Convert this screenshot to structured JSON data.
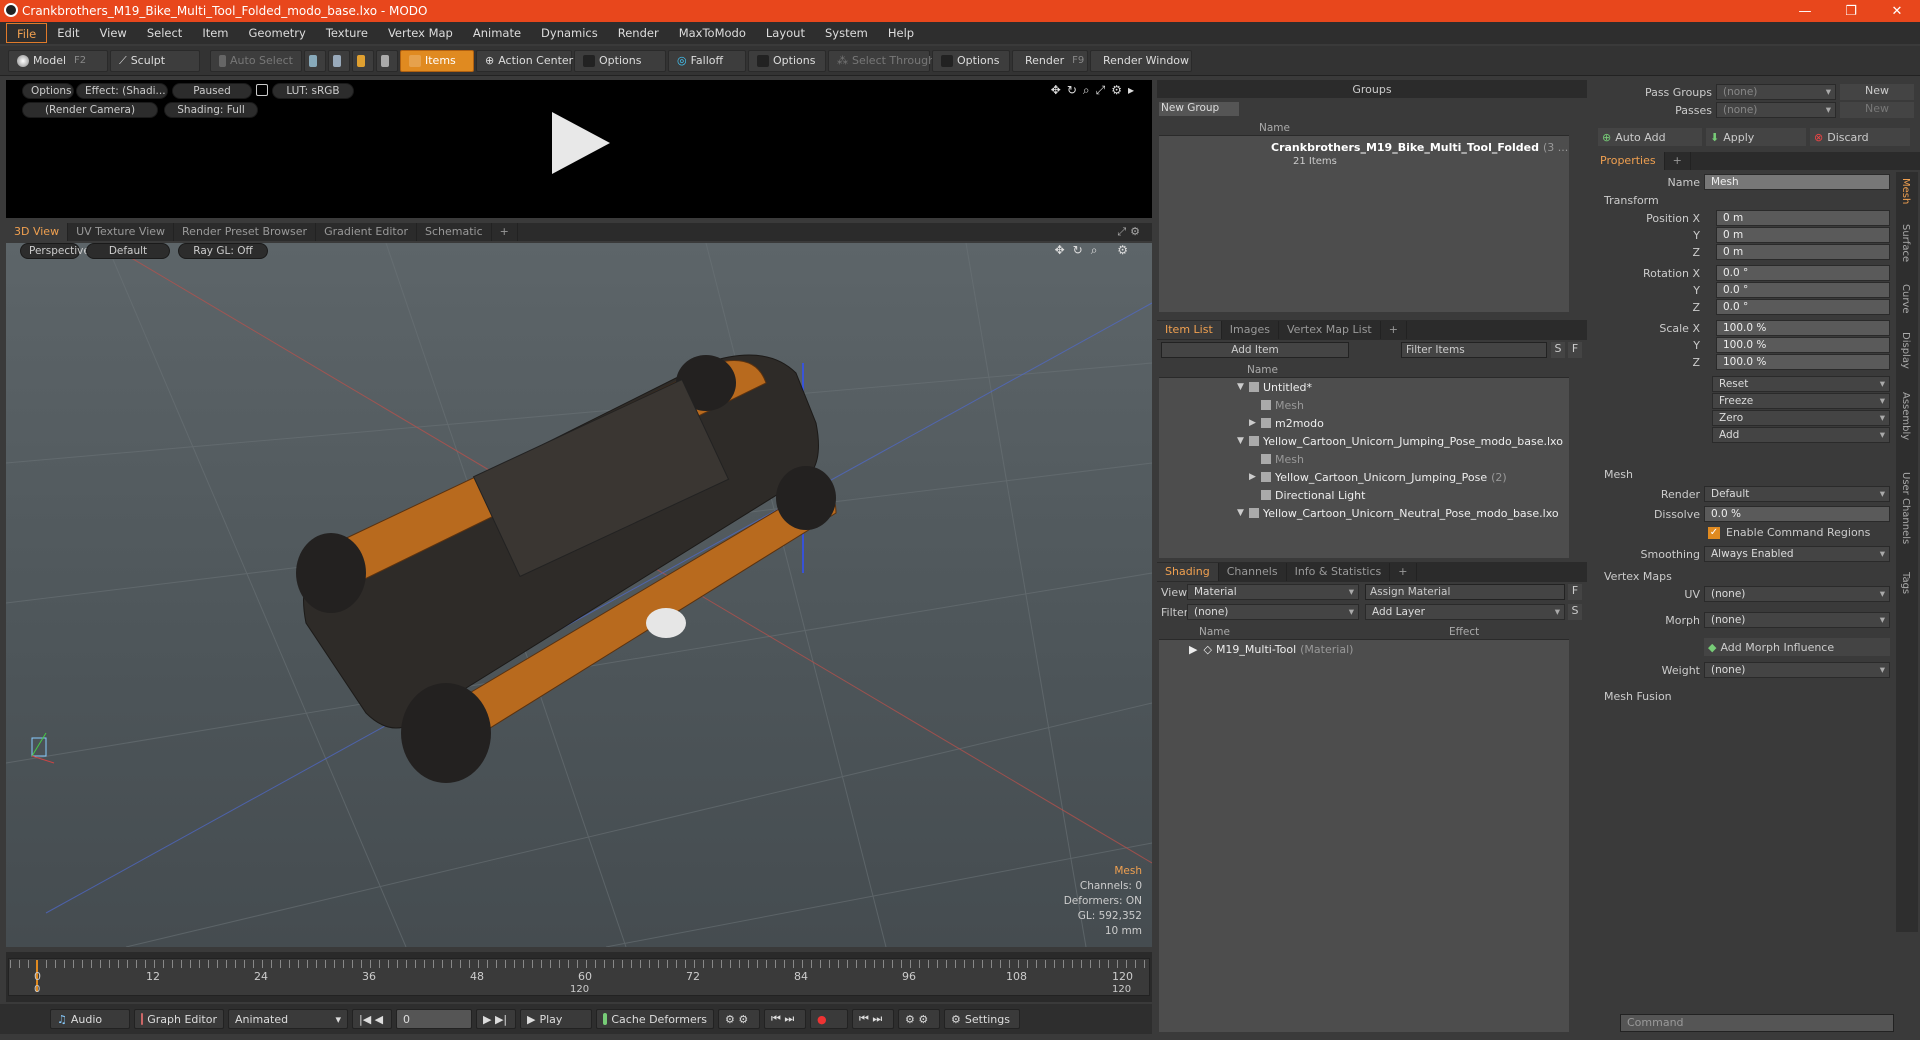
{
  "window": {
    "title": "Crankbrothers_M19_Bike_Multi_Tool_Folded_modo_base.lxo - MODO",
    "controls": [
      "—",
      "❐",
      "✕"
    ]
  },
  "menu": [
    "File",
    "Edit",
    "View",
    "Select",
    "Item",
    "Geometry",
    "Texture",
    "Vertex Map",
    "Animate",
    "Dynamics",
    "Render",
    "MaxToModo",
    "Layout",
    "System",
    "Help"
  ],
  "toolbar": {
    "model": "Model",
    "model_key": "F2",
    "sculpt": "Sculpt",
    "auto_select": "Auto Select",
    "items": "Items",
    "action_center": "Action Center",
    "options1": "Options",
    "falloff": "Falloff",
    "options2": "Options",
    "select_through": "Select Through",
    "options3": "Options",
    "render": "Render",
    "render_key": "F9",
    "render_window": "Render Window"
  },
  "preview": {
    "options": "Options",
    "effect": "Effect: (Shadi...",
    "paused": "Paused",
    "lut": "LUT: sRGB",
    "camera": "(Render Camera)",
    "shading": "Shading: Full"
  },
  "viewtabs": [
    "3D View",
    "UV Texture View",
    "Render Preset Browser",
    "Gradient Editor",
    "Schematic",
    "+"
  ],
  "viewport": {
    "perspective": "Perspective",
    "default": "Default",
    "raygl": "Ray GL: Off",
    "info": {
      "title": "Mesh",
      "channels": "Channels: 0",
      "deformers": "Deformers: ON",
      "gl": "GL: 592,352",
      "unit": "10 mm"
    }
  },
  "timeline": {
    "ticks": [
      "0",
      "12",
      "24",
      "36",
      "48",
      "60",
      "72",
      "84",
      "96",
      "108",
      "120"
    ],
    "start": "0",
    "mid": "120",
    "end": "120"
  },
  "bottombar": {
    "audio": "Audio",
    "graph": "Graph Editor",
    "animated": "Animated",
    "frame": "0",
    "play": "Play",
    "cache": "Cache Deformers",
    "settings": "Settings"
  },
  "groups": {
    "title": "Groups",
    "new_group": "New Group",
    "col_name": "Name",
    "item": "Crankbrothers_M19_Bike_Multi_Tool_Folded",
    "item_count": "(3 ...",
    "sub": "21 Items"
  },
  "itemlist": {
    "tabs": [
      "Item List",
      "Images",
      "Vertex Map List",
      "+"
    ],
    "add_item": "Add Item",
    "filter": "Filter Items",
    "s": "S",
    "f": "F",
    "col_name": "Name",
    "rows": [
      {
        "label": "Untitled*",
        "indent": 0,
        "arrow": "▼",
        "dim": false
      },
      {
        "label": "Mesh",
        "indent": 1,
        "arrow": "",
        "dim": true
      },
      {
        "label": "m2modo",
        "indent": 1,
        "arrow": "▶",
        "dim": false
      },
      {
        "label": "Yellow_Cartoon_Unicorn_Jumping_Pose_modo_base.lxo",
        "indent": 0,
        "arrow": "▼",
        "dim": false
      },
      {
        "label": "Mesh",
        "indent": 1,
        "arrow": "",
        "dim": true
      },
      {
        "label": "Yellow_Cartoon_Unicorn_Jumping_Pose",
        "extra": "(2)",
        "indent": 1,
        "arrow": "▶",
        "dim": false
      },
      {
        "label": "Directional Light",
        "indent": 1,
        "arrow": "",
        "dim": false
      },
      {
        "label": "Yellow_Cartoon_Unicorn_Neutral_Pose_modo_base.lxo",
        "indent": 0,
        "arrow": "▼",
        "dim": false
      }
    ]
  },
  "shading": {
    "tabs": [
      "Shading",
      "Channels",
      "Info & Statistics",
      "+"
    ],
    "view_label": "View",
    "view_val": "Material",
    "assign": "Assign Material",
    "f": "F",
    "filter_label": "Filter",
    "filter_val": "(none)",
    "add_layer": "Add Layer",
    "s": "S",
    "col_name": "Name",
    "col_effect": "Effect",
    "item": "M19_Multi-Tool",
    "item_type": "(Material)"
  },
  "rightpanel": {
    "pass_groups": "Pass Groups",
    "pass_val": "(none)",
    "new1": "New",
    "passes": "Passes",
    "passes_val": "(none)",
    "new2": "New",
    "auto_add": "Auto Add",
    "apply": "Apply",
    "discard": "Discard",
    "properties": "Properties",
    "name_label": "Name",
    "name_val": "Mesh",
    "transform": "Transform",
    "position": "Position X",
    "rotation": "Rotation X",
    "scale": "Scale X",
    "y": "Y",
    "z": "Z",
    "pos": [
      "0 m",
      "0 m",
      "0 m"
    ],
    "rot": [
      "0.0 °",
      "0.0 °",
      "0.0 °"
    ],
    "scl": [
      "100.0 %",
      "100.0 %",
      "100.0 %"
    ],
    "reset": "Reset",
    "freeze": "Freeze",
    "zero": "Zero",
    "add": "Add",
    "mesh": "Mesh",
    "render_label": "Render",
    "render_val": "Default",
    "dissolve_label": "Dissolve",
    "dissolve_val": "0.0 %",
    "enable_cmd": "Enable Command Regions",
    "smoothing_label": "Smoothing",
    "smoothing_val": "Always Enabled",
    "vertex_maps": "Vertex Maps",
    "uv_label": "UV",
    "uv_val": "(none)",
    "morph_label": "Morph",
    "morph_val": "(none)",
    "add_morph": "Add Morph Influence",
    "weight_label": "Weight",
    "weight_val": "(none)",
    "mesh_fusion": "Mesh Fusion",
    "vtabs": [
      "Mesh",
      "Surface",
      "Curve",
      "Display",
      "Assembly",
      "User Channels",
      "Tags"
    ],
    "command": "Command"
  },
  "colors": {
    "accent": "#e8471c",
    "orange": "#e08a20",
    "tool": "#b86a1e"
  }
}
